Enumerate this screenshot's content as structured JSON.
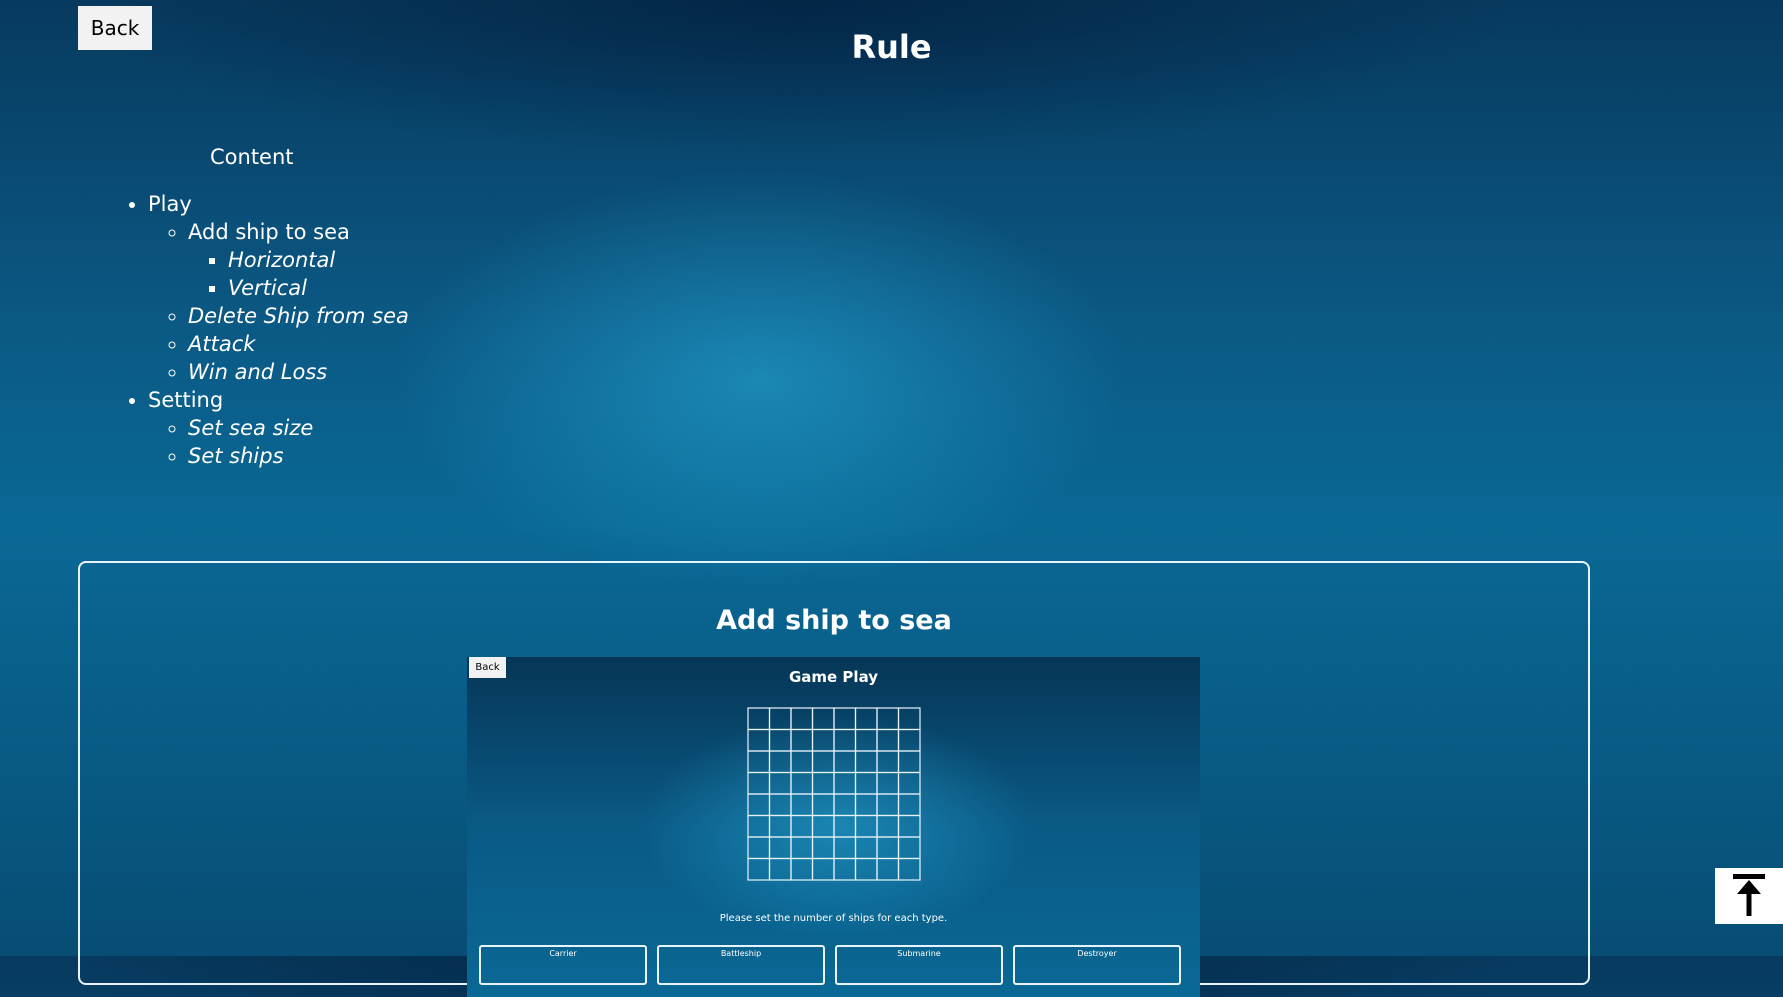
{
  "header": {
    "back_label": "Back",
    "title": "Rule"
  },
  "toc": {
    "heading": "Content",
    "items": [
      {
        "label": "Play",
        "children": [
          {
            "label": "Add ship to sea",
            "children": [
              {
                "label": "Horizontal"
              },
              {
                "label": "Vertical"
              }
            ]
          },
          {
            "label": "Delete Ship from sea"
          },
          {
            "label": "Attack"
          },
          {
            "label": "Win and Loss"
          }
        ]
      },
      {
        "label": "Setting",
        "children": [
          {
            "label": "Set sea size"
          },
          {
            "label": "Set ships"
          }
        ]
      }
    ]
  },
  "section": {
    "title": "Add ship to sea",
    "screenshot": {
      "back_label": "Back",
      "title": "Game Play",
      "grid": {
        "rows": 8,
        "cols": 8
      },
      "message": "Please set the number of ships for each type.",
      "ship_types": [
        "Carrier",
        "Battleship",
        "Submarine",
        "Destroyer"
      ]
    }
  },
  "scroll_top": {
    "icon": "arrow-up-to-top-icon"
  }
}
